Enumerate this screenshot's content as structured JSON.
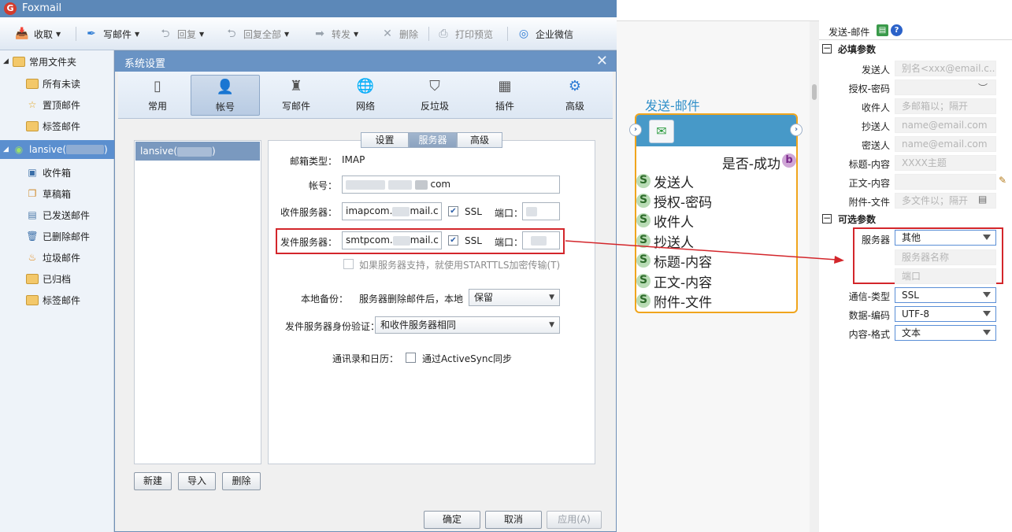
{
  "app": {
    "title": "Foxmail",
    "logo_letter": "G"
  },
  "toolbar": {
    "receive": "收取",
    "compose": "写邮件",
    "reply": "回复",
    "reply_all": "回复全部",
    "forward": "转发",
    "delete": "删除",
    "print_preview": "打印预览",
    "wecom": "企业微信"
  },
  "sidebar": {
    "common_group": "常用文件夹",
    "common_items": [
      "所有未读",
      "置顶邮件",
      "标签邮件"
    ],
    "account_name": "lansive(",
    "account_close": ")",
    "account_items": [
      "收件箱",
      "草稿箱",
      "已发送邮件",
      "已删除邮件",
      "垃圾邮件",
      "已归档",
      "标签邮件"
    ]
  },
  "dialog": {
    "title": "系统设置",
    "close_glyph": "✕",
    "tabs": [
      "常用",
      "帐号",
      "写邮件",
      "网络",
      "反垃圾",
      "插件",
      "高级"
    ],
    "account_item": "lansive(",
    "account_item_close": ")",
    "subtabs": [
      "设置",
      "服务器",
      "高级"
    ],
    "mailbox_type_label": "邮箱类型：",
    "mailbox_type_value": "IMAP",
    "account_label": "帐号：",
    "account_value_suffix": "com",
    "incoming_label": "收件服务器：",
    "incoming_prefix": "imapcom.",
    "incoming_suffix": "mail.c",
    "outgoing_label": "发件服务器：",
    "outgoing_prefix": "smtpcom.",
    "outgoing_suffix": "mail.c",
    "ssl_label": "SSL",
    "port_label": "端口：",
    "starttls_label": "如果服务器支持，就使用STARTTLS加密传输(T)",
    "backup_label": "本地备份：",
    "backup_text": "服务器删除邮件后，本地",
    "backup_value": "保留",
    "auth_label": "发件服务器身份验证：",
    "auth_value": "和收件服务器相同",
    "contacts_label": "通讯录和日历：",
    "activesync_label": "通过ActiveSync同步",
    "new_button": "新建",
    "import_button": "导入",
    "delete_button": "删除",
    "ok_button": "确定",
    "cancel_button": "取消",
    "apply_button": "应用(A)"
  },
  "node": {
    "title": "发送-邮件",
    "output": "是否-成功",
    "output_port": "b",
    "input_port": "S",
    "inputs": [
      "发送人",
      "授权-密码",
      "收件人",
      "抄送人",
      "标题-内容",
      "正文-内容",
      "附件-文件"
    ]
  },
  "props": {
    "header": "发送-邮件",
    "required_section": "必填参数",
    "optional_section": "可选参数",
    "required": [
      {
        "label": "发送人",
        "placeholder": "别名<xxx@email.c..."
      },
      {
        "label": "授权-密码",
        "placeholder": ""
      },
      {
        "label": "收件人",
        "placeholder": "多邮箱以；隔开"
      },
      {
        "label": "抄送人",
        "placeholder": "name@email.com"
      },
      {
        "label": "密送人",
        "placeholder": "name@email.com"
      },
      {
        "label": "标题-内容",
        "placeholder": "XXXX主题"
      },
      {
        "label": "正文-内容",
        "placeholder": ""
      },
      {
        "label": "附件-文件",
        "placeholder": "多文件以；隔开"
      }
    ],
    "server_label": "服务器",
    "server_value": "其他",
    "server_name_placeholder": "服务器名称",
    "port_placeholder": "端口",
    "comm_type_label": "通信-类型",
    "comm_type_value": "SSL",
    "encoding_label": "数据-编码",
    "encoding_value": "UTF-8",
    "format_label": "内容-格式",
    "format_value": "文本"
  },
  "colors": {
    "accent": "#5c88b8",
    "highlight_red": "#d3262b",
    "node_header": "#4799c8",
    "node_border": "#f0a51d"
  }
}
